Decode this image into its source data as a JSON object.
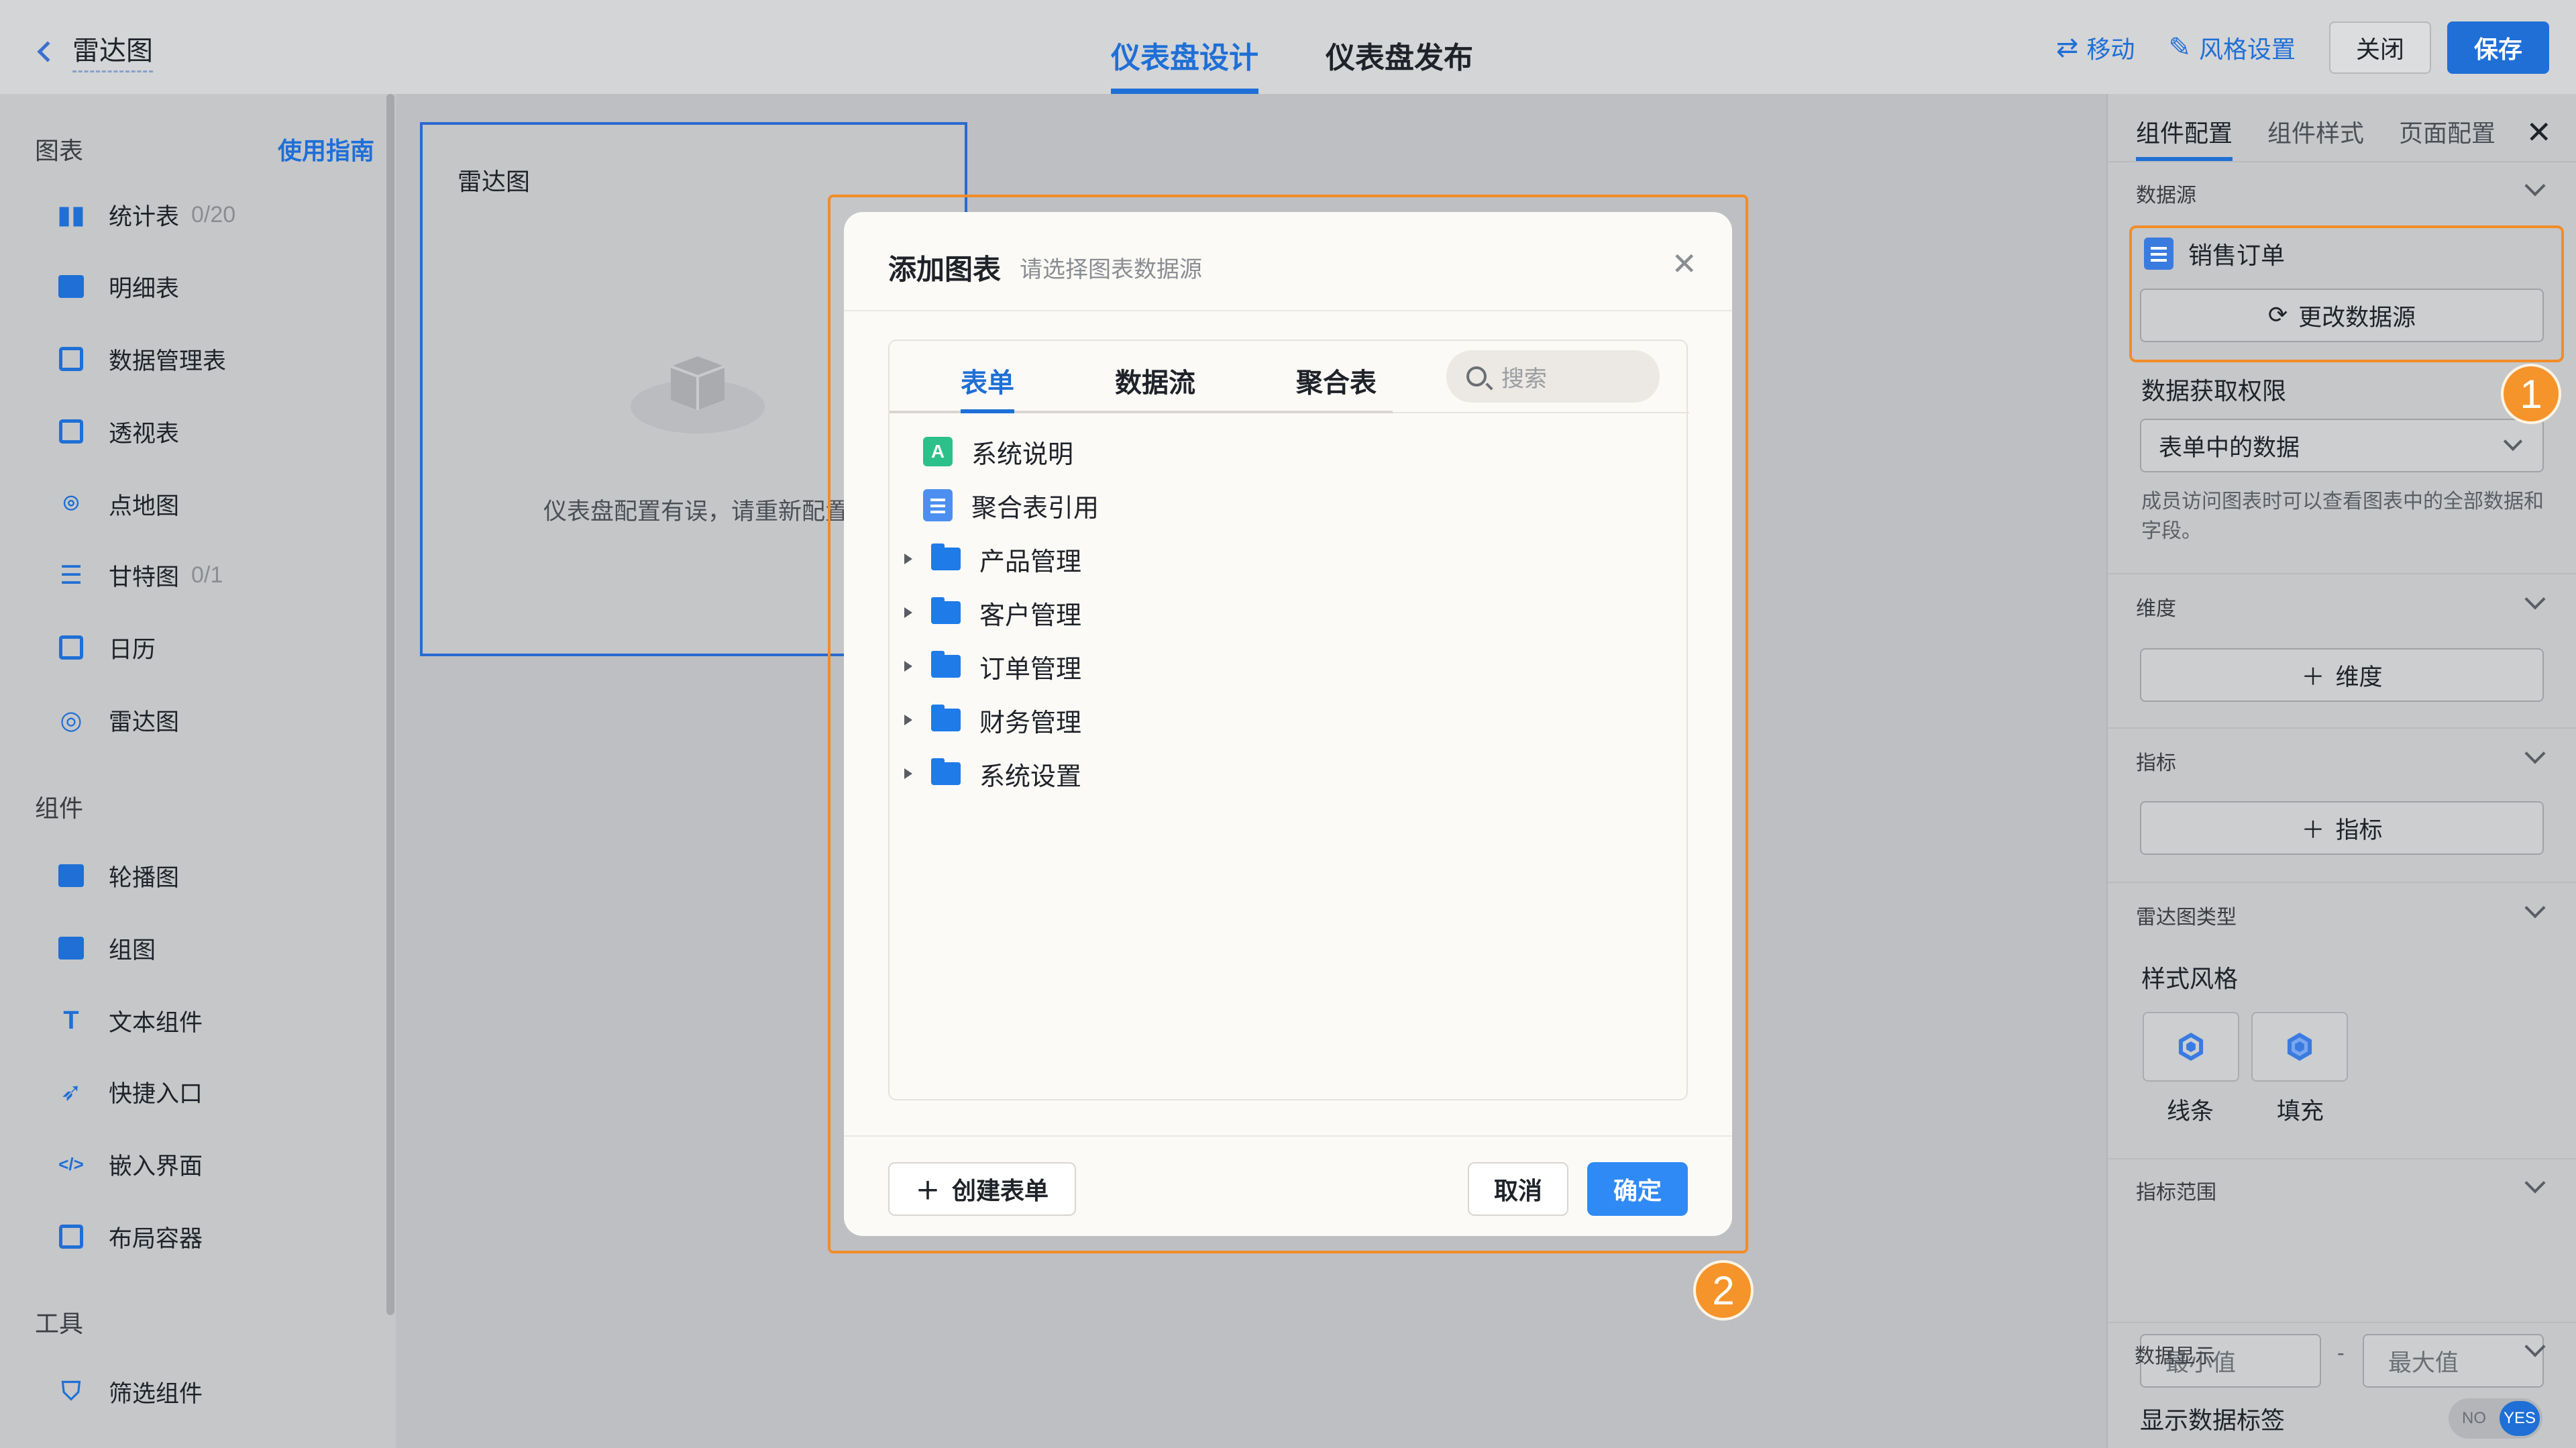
{
  "header": {
    "back_title": "雷达图",
    "tabs": [
      {
        "label": "仪表盘设计",
        "active": true
      },
      {
        "label": "仪表盘发布",
        "active": false
      }
    ],
    "actions": {
      "move_label": "移动",
      "style_label": "风格设置",
      "close_label": "关闭",
      "save_label": "保存"
    }
  },
  "sidebar": {
    "charts_heading": "图表",
    "guide_link": "使用指南",
    "chart_items": [
      {
        "label": "统计表",
        "count": "0/20",
        "icon": "bar-chart-icon"
      },
      {
        "label": "明细表",
        "count": "",
        "icon": "list-table-icon"
      },
      {
        "label": "数据管理表",
        "count": "",
        "icon": "data-table-icon"
      },
      {
        "label": "透视表",
        "count": "",
        "icon": "pivot-table-icon"
      },
      {
        "label": "点地图",
        "count": "",
        "icon": "map-pin-icon"
      },
      {
        "label": "甘特图",
        "count": "0/1",
        "icon": "gantt-icon"
      },
      {
        "label": "日历",
        "count": "",
        "icon": "calendar-icon"
      },
      {
        "label": "雷达图",
        "count": "",
        "icon": "radar-icon"
      }
    ],
    "components_heading": "组件",
    "component_items": [
      {
        "label": "轮播图",
        "icon": "carousel-icon"
      },
      {
        "label": "组图",
        "icon": "image-group-icon"
      },
      {
        "label": "文本组件",
        "icon": "text-icon"
      },
      {
        "label": "快捷入口",
        "icon": "rocket-icon"
      },
      {
        "label": "嵌入界面",
        "icon": "embed-code-icon"
      },
      {
        "label": "布局容器",
        "icon": "layout-icon"
      }
    ],
    "tools_heading": "工具",
    "tool_items": [
      {
        "label": "筛选组件",
        "icon": "filter-icon"
      }
    ]
  },
  "canvas": {
    "card_title": "雷达图",
    "error_text": "仪表盘配置有误，请重新配置"
  },
  "right_panel": {
    "tabs": [
      {
        "label": "组件配置",
        "active": true
      },
      {
        "label": "组件样式",
        "active": false
      },
      {
        "label": "页面配置",
        "active": false
      }
    ],
    "data_source_heading": "数据源",
    "data_source_name": "销售订单",
    "change_source_label": "更改数据源",
    "permission_label": "数据获取权限",
    "permission_value": "表单中的数据",
    "permission_hint": "成员访问图表时可以查看图表中的全部数据和字段。",
    "dimension_heading": "维度",
    "dimension_add": "维度",
    "metric_heading": "指标",
    "metric_add": "指标",
    "radar_type_heading": "雷达图类型",
    "style_label": "样式风格",
    "style_options": [
      "线条",
      "填充"
    ],
    "range_heading": "指标范围",
    "range_min_placeholder": "最小值",
    "range_sep": "-",
    "range_max_placeholder": "最大值",
    "display_heading": "数据显示",
    "show_labels_label": "显示数据标签",
    "toggle_no": "NO",
    "toggle_yes": "YES"
  },
  "badges": {
    "one": "1",
    "two": "2"
  },
  "modal": {
    "title": "添加图表",
    "subtitle": "请选择图表数据源",
    "tabs": [
      {
        "label": "表单",
        "active": true
      },
      {
        "label": "数据流",
        "active": false
      },
      {
        "label": "聚合表",
        "active": false
      }
    ],
    "search_placeholder": "搜索",
    "tree": [
      {
        "label": "系统说明",
        "type": "app"
      },
      {
        "label": "聚合表引用",
        "type": "doc"
      },
      {
        "label": "产品管理",
        "type": "folder"
      },
      {
        "label": "客户管理",
        "type": "folder"
      },
      {
        "label": "订单管理",
        "type": "folder"
      },
      {
        "label": "财务管理",
        "type": "folder"
      },
      {
        "label": "系统设置",
        "type": "folder"
      }
    ],
    "create_label": "创建表单",
    "cancel_label": "取消",
    "ok_label": "确定"
  },
  "colors": {
    "accent": "#1f6fd6",
    "highlight": "#f28c28"
  }
}
